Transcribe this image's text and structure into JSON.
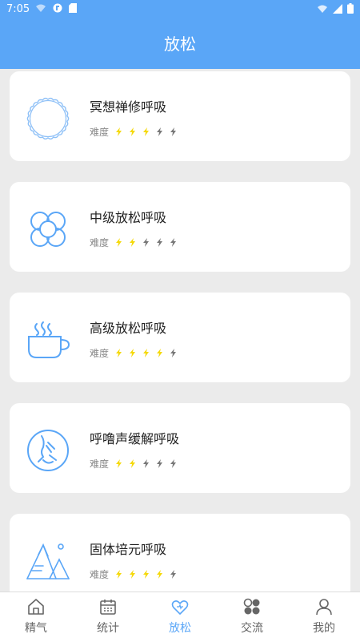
{
  "status_bar": {
    "time": "7:05"
  },
  "header": {
    "title": "放松"
  },
  "difficulty_label": "难度",
  "items": [
    {
      "name": "冥想禅修呼吸",
      "difficulty": 3,
      "max": 5,
      "icon": "scalloped-circle-icon"
    },
    {
      "name": "中级放松呼吸",
      "difficulty": 2,
      "max": 5,
      "icon": "flower-icon"
    },
    {
      "name": "高级放松呼吸",
      "difficulty": 4,
      "max": 5,
      "icon": "coffee-cup-icon"
    },
    {
      "name": "呼噜声缓解呼吸",
      "difficulty": 2,
      "max": 5,
      "icon": "snoring-face-icon"
    },
    {
      "name": "固体培元呼吸",
      "difficulty": 4,
      "max": 5,
      "icon": "mountain-icon"
    }
  ],
  "nav": [
    {
      "label": "精气",
      "icon": "home-icon",
      "active": false
    },
    {
      "label": "统计",
      "icon": "calendar-icon",
      "active": false
    },
    {
      "label": "放松",
      "icon": "heart-icon",
      "active": true
    },
    {
      "label": "交流",
      "icon": "chat-bubbles-icon",
      "active": false
    },
    {
      "label": "我的",
      "icon": "person-icon",
      "active": false
    }
  ],
  "colors": {
    "accent": "#5aa6f7",
    "bolt_active": "#f5d90a",
    "bolt_inactive": "#777777"
  }
}
